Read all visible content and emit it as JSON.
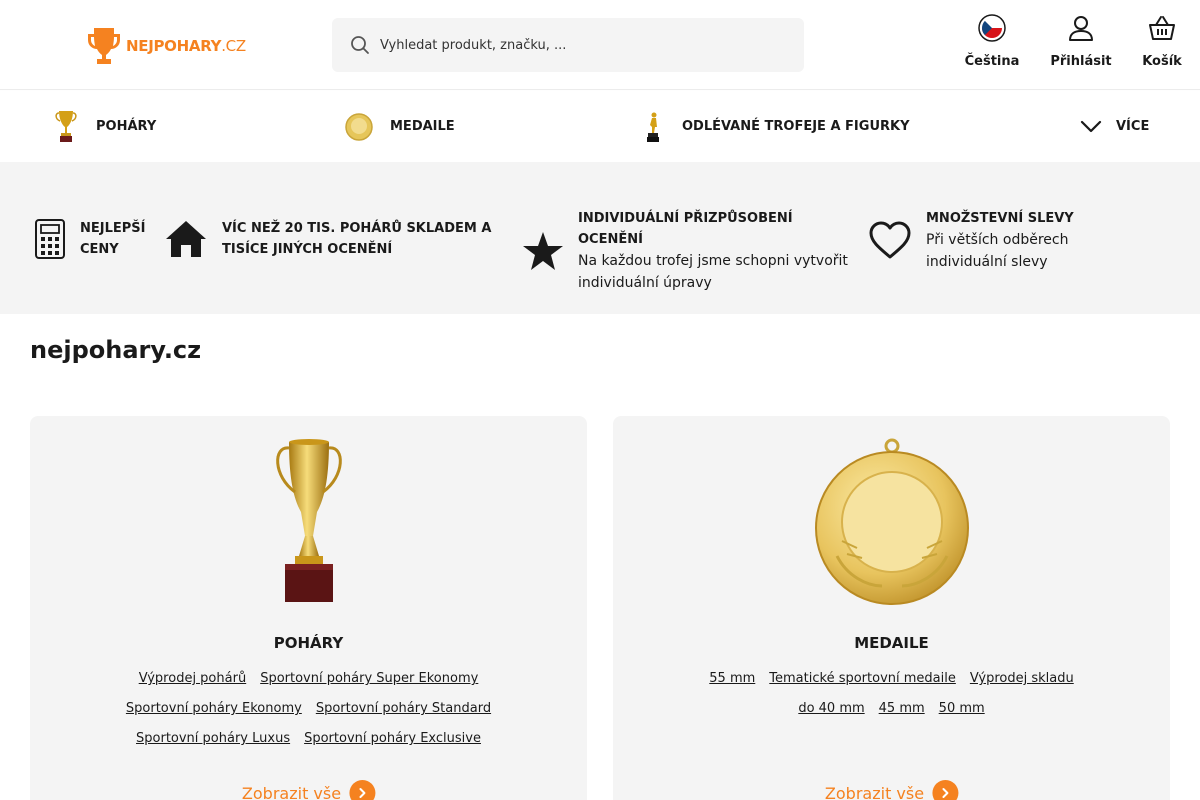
{
  "header": {
    "logo": {
      "text_main": "NEJPOHARY",
      "text_tld": ".CZ"
    },
    "search": {
      "placeholder": "Vyhledat produkt, značku, ..."
    },
    "actions": {
      "language": "Čeština",
      "login": "Přihlásit",
      "cart": "Košík"
    }
  },
  "nav": {
    "items": [
      {
        "label": "POHÁRY",
        "icon": "trophy-thumb-icon"
      },
      {
        "label": "MEDAILE",
        "icon": "medal-thumb-icon"
      },
      {
        "label": "ODLÉVANÉ TROFEJE A FIGURKY",
        "icon": "figurine-thumb-icon"
      }
    ],
    "more_label": "VÍCE"
  },
  "benefits": [
    {
      "icon": "calculator-icon",
      "title": "NEJLEPŠÍ CENY",
      "desc": ""
    },
    {
      "icon": "house-icon",
      "title": "VÍC NEŽ 20 TIS. POHÁRŮ SKLADEM A TISÍCE JINÝCH OCENĚNÍ",
      "desc": ""
    },
    {
      "icon": "star-icon",
      "title": "INDIVIDUÁLNÍ PŘIZPŮSOBENÍ OCENĚNÍ",
      "desc": "Na každou trofej jsme schopni vytvořit individuální úpravy"
    },
    {
      "icon": "heart-icon",
      "title": "MNOŽSTEVNÍ SLEVY",
      "desc": "Při větších odběrech individuální slevy"
    }
  ],
  "page_title": "nejpohary.cz",
  "categories": [
    {
      "title": "POHÁRY",
      "links": [
        "Výprodej pohárů",
        "Sportovní poháry Super Ekonomy",
        "Sportovní poháry Ekonomy",
        "Sportovní poháry Standard",
        "Sportovní poháry Luxus",
        "Sportovní poháry Exclusive"
      ],
      "show_all": "Zobrazit vše"
    },
    {
      "title": "MEDAILE",
      "links": [
        "55 mm",
        "Tematické sportovní medaile",
        "Výprodej skladu",
        "do 40 mm",
        "45 mm",
        "50 mm"
      ],
      "show_all": "Zobrazit vše"
    }
  ],
  "colors": {
    "brand_orange": "#f58220",
    "gold": "#d4a017",
    "panel_bg": "#f4f4f4"
  }
}
